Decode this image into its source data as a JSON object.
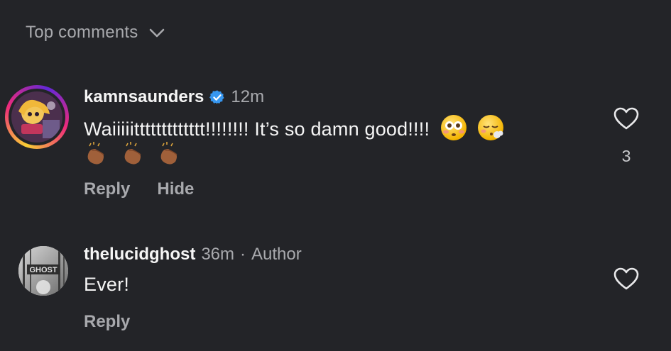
{
  "header": {
    "sort_label": "Top comments",
    "chevron_icon": "chevron-down-icon"
  },
  "colors": {
    "background": "#232428",
    "primary_text": "#f5f5f5",
    "secondary_text": "#a8a9ad",
    "verified_blue": "#3797f0"
  },
  "comments": [
    {
      "username": "kamnsaunders",
      "verified": true,
      "time": "12m",
      "author_tag": "",
      "text": "Waiiiiittttttttttttt!!!!!!!! It’s so damn good!!!!",
      "text_emojis": [
        "flushed-face",
        "face-exhaling"
      ],
      "second_line_emojis": [
        "clapping-hands",
        "clapping-hands",
        "clapping-hands"
      ],
      "has_story_ring": true,
      "actions": {
        "reply": "Reply",
        "hide": "Hide"
      },
      "like_count": "3",
      "like_icon": "heart-outline-icon"
    },
    {
      "username": "thelucidghost",
      "verified": false,
      "time": "36m",
      "author_separator": "·",
      "author_tag": "Author",
      "text": "Ever!",
      "has_story_ring": false,
      "actions": {
        "reply": "Reply"
      },
      "like_count": "",
      "like_icon": "heart-outline-icon"
    }
  ]
}
